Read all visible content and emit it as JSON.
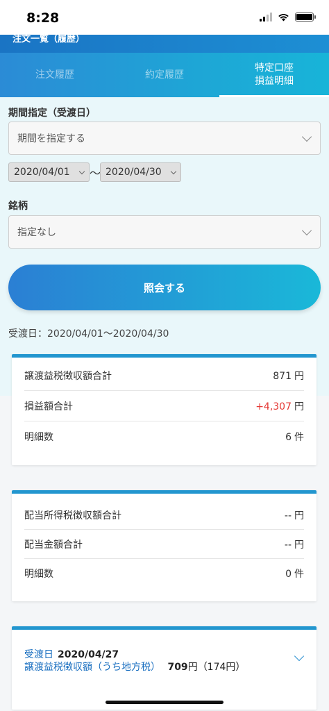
{
  "status_bar": {
    "time": "8:28"
  },
  "header": {
    "title": "注文一覧（履歴）"
  },
  "tabs": [
    {
      "label": "注文履歴",
      "active": false
    },
    {
      "label": "約定履歴",
      "active": false
    },
    {
      "label": "特定口座\n損益明細",
      "active": true
    }
  ],
  "filter": {
    "period_label": "期間指定（受渡日）",
    "period_select": "期間を指定する",
    "date_from": "2020/04/01",
    "tilde": "〜",
    "date_to": "2020/04/30",
    "stock_label": "銘柄",
    "stock_select": "指定なし",
    "submit_label": "照会する"
  },
  "receive_range": "受渡日：2020/04/01〜2020/04/30",
  "summary_transfer": {
    "rows": [
      {
        "label": "譲渡益税徴収額合計",
        "value": "871",
        "unit": "円"
      },
      {
        "label": "損益額合計",
        "value": "+4,307",
        "unit": "円"
      },
      {
        "label": "明細数",
        "value": "6",
        "unit": "件"
      }
    ]
  },
  "summary_dividend": {
    "rows": [
      {
        "label": "配当所得税徴収額合計",
        "value": "--",
        "unit": "円"
      },
      {
        "label": "配当金額合計",
        "value": "--",
        "unit": "円"
      },
      {
        "label": "明細数",
        "value": "0",
        "unit": "件"
      }
    ]
  },
  "detail_card": {
    "date_label": "受渡日",
    "date": "2020/04/27",
    "tax_label": "譲渡益税徴収額（うち地方税）",
    "tax_value": "709",
    "tax_unit": "円",
    "local_tax": "（174円）"
  },
  "colors": {
    "accent": "#1a74c4",
    "profit": "#e53935"
  }
}
